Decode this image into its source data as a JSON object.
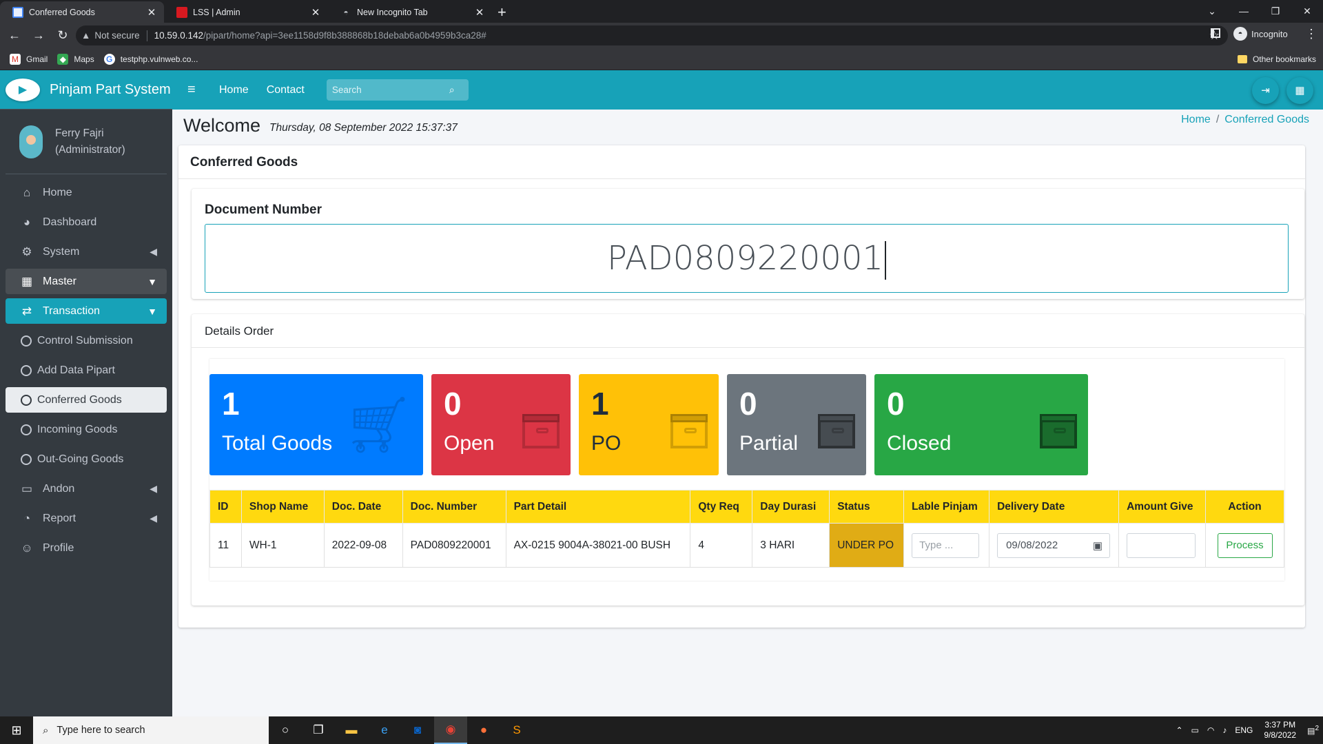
{
  "browser": {
    "tabs": [
      {
        "title": "Conferred Goods",
        "active": true
      },
      {
        "title": "LSS | Admin",
        "active": false
      },
      {
        "title": "New Incognito Tab",
        "active": false
      }
    ],
    "security": "Not secure",
    "url_host": "10.59.0.142",
    "url_path": "/pipart/home?api=3ee1158d9f8b388868b18debab6a0b4959b3ca28#",
    "profile": "Incognito",
    "bookmarks": [
      "Gmail",
      "Maps",
      "testphp.vulnweb.co..."
    ],
    "other_bookmarks": "Other bookmarks"
  },
  "app": {
    "brand": "Pinjam Part System",
    "user_name": "Ferry Fajri",
    "user_role": "(Administrator)",
    "sidebar": [
      {
        "label": "Home",
        "icon": "home-icon"
      },
      {
        "label": "Dashboard",
        "icon": "dashboard-icon"
      },
      {
        "label": "System",
        "icon": "gear-icon"
      },
      {
        "label": "Master",
        "icon": "table-icon"
      },
      {
        "label": "Transaction",
        "icon": "exchange-icon"
      },
      {
        "label": "Control Submission",
        "icon": "circle-icon"
      },
      {
        "label": "Add Data Pipart",
        "icon": "circle-icon"
      },
      {
        "label": "Conferred Goods",
        "icon": "circle-icon"
      },
      {
        "label": "Incoming Goods",
        "icon": "circle-icon"
      },
      {
        "label": "Out-Going Goods",
        "icon": "circle-icon"
      },
      {
        "label": "Andon",
        "icon": "desktop-icon"
      },
      {
        "label": "Report",
        "icon": "pie-chart-icon"
      },
      {
        "label": "Profile",
        "icon": "user-gear-icon"
      }
    ],
    "navbar": {
      "home": "Home",
      "contact": "Contact",
      "search_placeholder": "Search"
    }
  },
  "page": {
    "welcome": "Welcome",
    "datetime": "Thursday, 08 September 2022 15:37:37",
    "breadcrumb": [
      "Home",
      "Conferred Goods"
    ],
    "card_title": "Conferred Goods",
    "doc_label": "Document Number",
    "doc_value": "PAD0809220001",
    "details_title": "Details Order",
    "stats": [
      {
        "value": "1",
        "label": "Total Goods",
        "color": "#007bff"
      },
      {
        "value": "0",
        "label": "Open",
        "color": "#dc3545"
      },
      {
        "value": "1",
        "label": "PO",
        "color": "#ffc107"
      },
      {
        "value": "0",
        "label": "Partial",
        "color": "#6c757d"
      },
      {
        "value": "0",
        "label": "Closed",
        "color": "#28a745"
      }
    ],
    "table": {
      "headers": [
        "ID",
        "Shop Name",
        "Doc. Date",
        "Doc. Number",
        "Part Detail",
        "Qty Req",
        "Day Durasi",
        "Status",
        "Lable Pinjam",
        "Delivery Date",
        "Amount Give",
        "Action"
      ],
      "rows": [
        {
          "id": "11",
          "shop": "WH-1",
          "doc_date": "2022-09-08",
          "doc_number": "PAD0809220001",
          "part": "AX-0215 9004A-38021-00 BUSH",
          "qty": "4",
          "durasi": "3 HARI",
          "status": "UNDER PO",
          "lable_placeholder": "Type ...",
          "delivery_date": "09/08/2022",
          "action": "Process"
        }
      ]
    }
  },
  "taskbar": {
    "search_placeholder": "Type here to search",
    "lang": "ENG",
    "time": "3:37 PM",
    "date": "9/8/2022",
    "notifications": "2"
  }
}
